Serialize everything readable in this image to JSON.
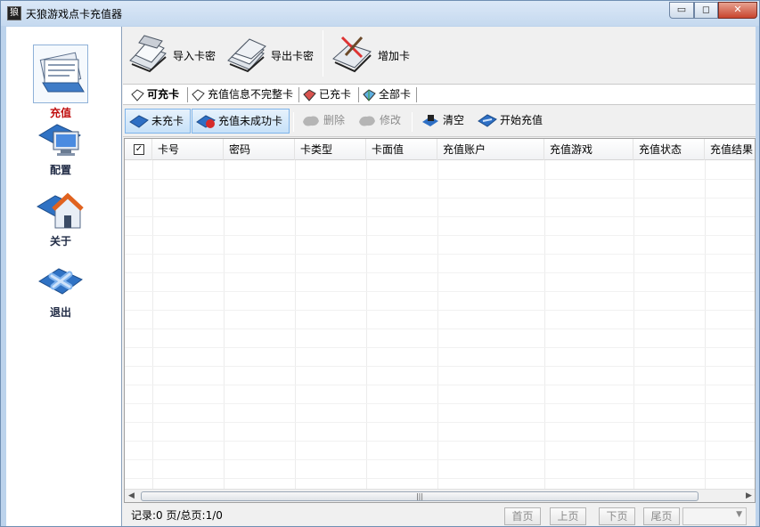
{
  "window": {
    "title": "天狼游戏点卡充值器",
    "min_glyph": "▭",
    "max_glyph": "◻",
    "close_glyph": "✕",
    "app_icon_glyph": "狼"
  },
  "sidebar": {
    "items": [
      {
        "label": "充值",
        "icon": "newspaper-icon",
        "selected": true
      },
      {
        "label": "配置",
        "icon": "monitor-settings-icon",
        "selected": false
      },
      {
        "label": "关于",
        "icon": "house-icon",
        "selected": false
      },
      {
        "label": "退出",
        "icon": "exit-x-icon",
        "selected": false
      }
    ]
  },
  "toolbar1": {
    "import_label": "导入卡密",
    "export_label": "导出卡密",
    "add_label": "增加卡"
  },
  "tabs": [
    {
      "label": "可充卡",
      "active": true
    },
    {
      "label": "充值信息不完整卡",
      "active": false
    },
    {
      "label": "已充卡",
      "active": false
    },
    {
      "label": "全部卡",
      "active": false
    }
  ],
  "toolbar2": {
    "unrecharged_label": "未充卡",
    "failed_label": "充值未成功卡",
    "delete_label": "删除",
    "edit_label": "修改",
    "clear_label": "清空",
    "start_label": "开始充值"
  },
  "grid": {
    "select_all_glyph": "✓",
    "columns": [
      "卡号",
      "密码",
      "卡类型",
      "卡面值",
      "充值账户",
      "充值游戏",
      "充值状态",
      "充值结果"
    ],
    "rows": [],
    "scroll_grip": "|||",
    "scroll_left_glyph": "◀",
    "scroll_right_glyph": "▶"
  },
  "status": {
    "record_text": "记录:0 页/总页:1/0",
    "first_label": "首页",
    "prev_label": "上页",
    "next_label": "下页",
    "last_label": "尾页",
    "page_select_value": "",
    "dropdown_glyph": "▼"
  },
  "colors": {
    "accent_selected": "#c01010",
    "window_frame": "#bcd3ec",
    "checked_button": "#c7e1f8"
  }
}
